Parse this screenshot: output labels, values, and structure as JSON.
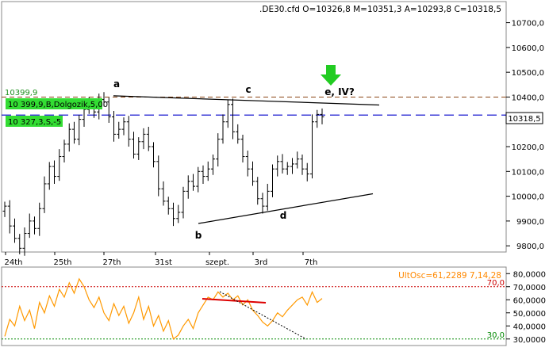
{
  "header": {
    "ohlc": ".DE30.cfd O=10326,8 M=10351,3 A=10293,8 C=10318,5"
  },
  "colors": {
    "accent_green": "#33dd33",
    "level_line": "#0000cc",
    "resist_line": "#8b4513",
    "osc_line": "#ff9900",
    "osc_upper": "#cc0000",
    "osc_lower": "#008800",
    "trend_red": "#dd0000"
  },
  "chart_data": [
    {
      "type": "bar",
      "description": "OHLC price chart",
      "y_ticks": [
        "10700,0",
        "10600,0",
        "10500,0",
        "10400,0",
        "10318,5",
        "10200,0",
        "10100,0",
        "10000,0",
        "9900,0",
        "9800,0"
      ],
      "ylim": [
        9775,
        10785
      ],
      "x_tick_labels": [
        "24th",
        "25th",
        "27th",
        "31st",
        "szept.",
        "3rd",
        "7th"
      ],
      "current_price_label": "10318,5",
      "resistance_level": {
        "value": 10399.9,
        "label": "10399,9"
      },
      "order_labels": [
        "10 399,9,B,Dolgozik,5,00",
        "10 327,3,S,-5"
      ],
      "short_level": 10327.3,
      "wave_labels": [
        "a",
        "b",
        "c",
        "d",
        "e, IV?"
      ],
      "triangle_upper": [
        {
          "date": "27th",
          "y": 10405
        },
        {
          "date": "7th+",
          "y": 10368
        }
      ],
      "triangle_lower": [
        {
          "date": "31st+",
          "y": 9890
        },
        {
          "date": "7th++",
          "y": 10010
        }
      ],
      "closes": [
        9960,
        9880,
        9830,
        9790,
        9850,
        9900,
        9870,
        9950,
        10050,
        10120,
        10080,
        10160,
        10210,
        10270,
        10230,
        10310,
        10350,
        10370,
        10340,
        10390,
        10380,
        10320,
        10250,
        10270,
        10300,
        10230,
        10170,
        10220,
        10250,
        10200,
        10140,
        10030,
        9980,
        9950,
        9910,
        9935,
        10020,
        10060,
        10040,
        10100,
        10080,
        10110,
        10150,
        10230,
        10300,
        10370,
        10260,
        10230,
        10160,
        10110,
        10060,
        9990,
        9960,
        10020,
        10110,
        10140,
        10110,
        10120,
        10130,
        10150,
        10110,
        10090,
        10300,
        10330,
        10320
      ]
    },
    {
      "type": "line",
      "name": "UltOsc",
      "title": "UltOsc=61,2289  7,14,28",
      "y_ticks": [
        "80,0000",
        "70,0000",
        "60,0000",
        "50,0000",
        "40,0000",
        "30,0000"
      ],
      "ylim": [
        25,
        85
      ],
      "upper_level": {
        "value": 70,
        "label": "70,0"
      },
      "lower_level": {
        "value": 30,
        "label": "30,0"
      },
      "values": [
        32,
        45,
        40,
        55,
        44,
        52,
        38,
        58,
        50,
        63,
        55,
        68,
        62,
        73,
        65,
        76,
        70,
        60,
        54,
        62,
        50,
        44,
        57,
        48,
        55,
        42,
        50,
        62,
        45,
        55,
        40,
        48,
        36,
        44,
        30,
        33,
        40,
        45,
        38,
        50,
        56,
        62,
        60,
        66,
        62,
        65,
        60,
        63,
        56,
        60,
        52,
        48,
        43,
        40,
        44,
        50,
        47,
        52,
        56,
        60,
        62,
        56,
        66,
        58,
        61
      ]
    }
  ]
}
